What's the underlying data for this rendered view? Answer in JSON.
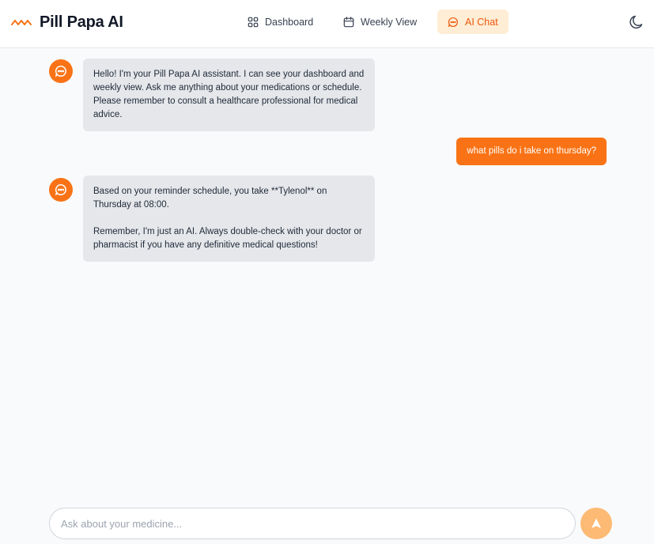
{
  "app": {
    "title": "Pill Papa AI"
  },
  "nav": {
    "dashboard": "Dashboard",
    "weekly": "Weekly View",
    "chat": "AI Chat"
  },
  "messages": [
    {
      "role": "assistant",
      "text": "Hello! I'm your Pill Papa AI assistant. I can see your dashboard and weekly view. Ask me anything about your medications or schedule. Please remember to consult a healthcare professional for medical advice."
    },
    {
      "role": "user",
      "text": "what pills do i take on thursday?"
    },
    {
      "role": "assistant",
      "text": "Based on your reminder schedule, you take **Tylenol** on Thursday at 08:00.\n\nRemember, I'm just an AI. Always double-check with your doctor or pharmacist if you have any definitive medical questions!"
    }
  ],
  "composer": {
    "placeholder": "Ask about your medicine...",
    "value": ""
  },
  "colors": {
    "accent": "#f97316",
    "accent_soft": "#ffedd5",
    "send_disabled": "#fdba74"
  },
  "icons": {
    "logo": "pill-wave-logo",
    "dashboard": "grid-icon",
    "weekly": "calendar-icon",
    "chat": "chat-bubble-icon",
    "theme": "moon-icon",
    "assistant": "chat-bubble-icon",
    "send": "send-arrow-icon"
  }
}
